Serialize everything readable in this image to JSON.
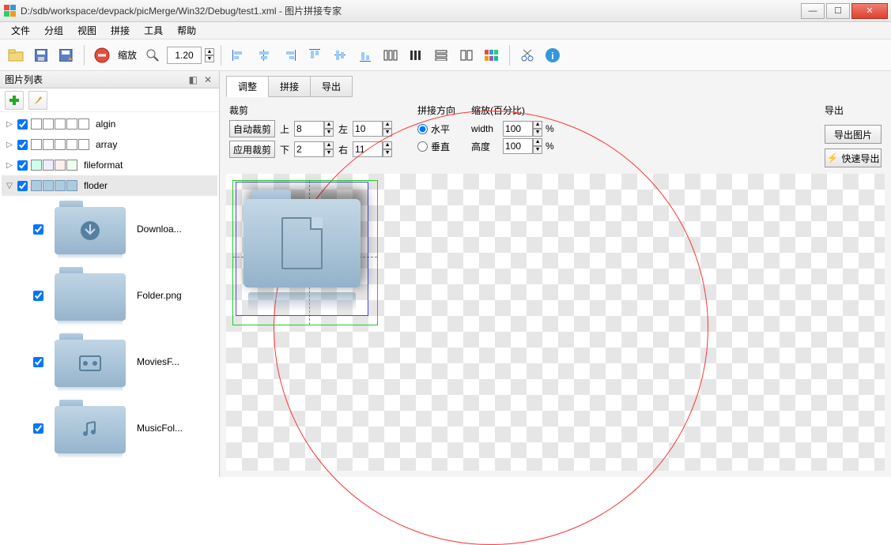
{
  "window": {
    "title": "D:/sdb/workspace/devpack/picMerge/Win32/Debug/test1.xml - 图片拼接专家"
  },
  "menu": [
    "文件",
    "分组",
    "视图",
    "拼接",
    "工具",
    "帮助"
  ],
  "toolbar": {
    "zoom_label": "缩放",
    "zoom_value": "1.20"
  },
  "sidebar": {
    "title": "图片列表",
    "groups": [
      {
        "label": "algin",
        "expanded": false
      },
      {
        "label": "array",
        "expanded": false
      },
      {
        "label": "fileformat",
        "expanded": false
      },
      {
        "label": "floder",
        "expanded": true
      }
    ],
    "thumbs": [
      {
        "label": "Downloa..."
      },
      {
        "label": "Folder.png"
      },
      {
        "label": "MoviesF..."
      },
      {
        "label": "MusicFol..."
      }
    ]
  },
  "tabs": [
    "调整",
    "拼接",
    "导出"
  ],
  "adjust": {
    "crop_title": "裁剪",
    "auto_crop": "自动裁剪",
    "apply_crop": "应用裁剪",
    "top_label": "上",
    "top_val": "8",
    "bottom_label": "下",
    "bottom_val": "2",
    "left_label": "左",
    "left_val": "10",
    "right_label": "右",
    "right_val": "11",
    "dir_title": "拼接方向",
    "horizontal": "水平",
    "vertical": "垂直",
    "scale_title": "缩放(百分比)",
    "width_label": "width",
    "width_val": "100",
    "height_label": "高度",
    "height_val": "100",
    "percent": "%",
    "export_title": "导出",
    "export_image": "导出图片",
    "quick_export": "快速导出"
  }
}
